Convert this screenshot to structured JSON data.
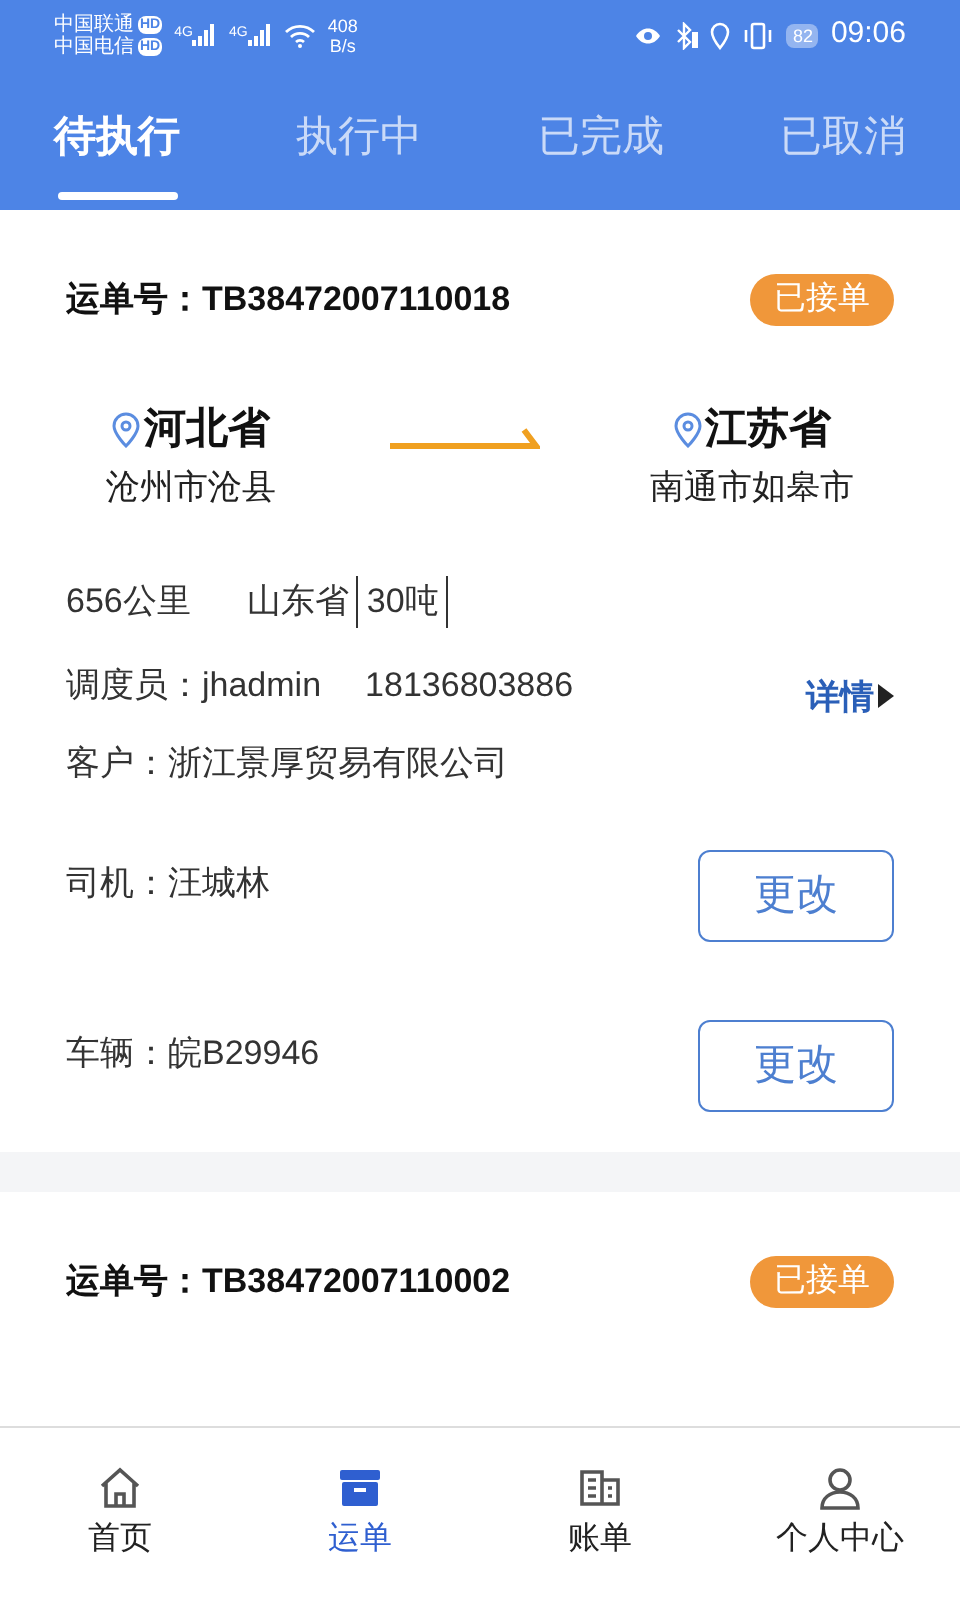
{
  "status_bar": {
    "carriers": [
      {
        "name": "中国联通",
        "badge": "HD"
      },
      {
        "name": "中国电信",
        "badge": "HD"
      }
    ],
    "networks": [
      "4G",
      "4G"
    ],
    "speed": "408",
    "speed_unit": "B/s",
    "battery": "82",
    "time": "09:06"
  },
  "tabs": [
    {
      "label": "待执行",
      "selected": true
    },
    {
      "label": "执行中",
      "selected": false
    },
    {
      "label": "已完成",
      "selected": false
    },
    {
      "label": "已取消",
      "selected": false
    }
  ],
  "orders": [
    {
      "number_label": "运单号：",
      "number": "TB38472007110018",
      "status": "已接单",
      "from": {
        "province": "河北省",
        "city": "沧州市沧县"
      },
      "to": {
        "province": "江苏省",
        "city": "南通市如皋市"
      },
      "distance": "656公里",
      "origin": "山东省",
      "weight": "30吨",
      "dispatcher": "调度员：jhadmin",
      "phone": "18136803886",
      "customer": "客户：浙江景厚贸易有限公司",
      "details": "详情",
      "driver": "司机：汪城林",
      "driver_button": "更改",
      "vehicle": "车辆：皖B29946",
      "vehicle_button": "更改"
    },
    {
      "number_label": "运单号：",
      "number": "TB38472007110002",
      "status": "已接单"
    }
  ],
  "nav": [
    {
      "label": "首页",
      "kind": "home",
      "selected": false
    },
    {
      "label": "运单",
      "kind": "box",
      "selected": true
    },
    {
      "label": "账单",
      "kind": "bill",
      "selected": false
    },
    {
      "label": "个人中心",
      "kind": "user",
      "selected": false
    }
  ]
}
